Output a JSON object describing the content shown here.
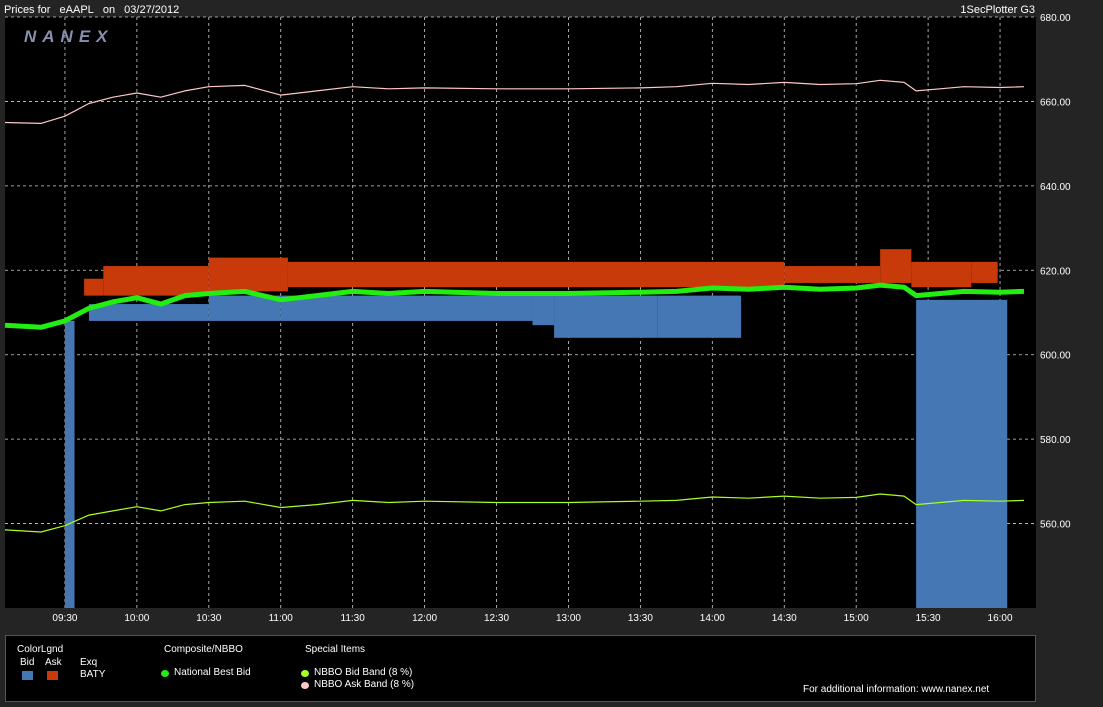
{
  "header": {
    "prefix": "Prices for",
    "symbol": "eAAPL",
    "on": "on",
    "date": "03/27/2012",
    "plotter": "1SecPlotter G3",
    "logo": "NANEX"
  },
  "colors": {
    "bid": "#4477b3",
    "ask": "#c83a0a",
    "nbb": "#22ee11",
    "nbbo_bid_band": "#aaff22",
    "nbbo_ask_band": "#ffc8c8",
    "grid": "#cfcfcf"
  },
  "legend": {
    "colorlgnd_title": "ColorLgnd",
    "bid_label": "Bid",
    "ask_label": "Ask",
    "exq_label": "Exq",
    "exchange": "BATY",
    "composite_title": "Composite/NBBO",
    "national_best_bid": "National Best Bid",
    "special_title": "Special Items",
    "nbbo_bid_band": "NBBO Bid Band (8 %)",
    "nbbo_ask_band": "NBBO Ask Band (8 %)",
    "info": "For additional information: www.nanex.net"
  },
  "chart_data": {
    "type": "line",
    "ylim": [
      540,
      680
    ],
    "xlim": [
      "09:05",
      "16:15"
    ],
    "x_ticks": [
      "09:30",
      "10:00",
      "10:30",
      "11:00",
      "11:30",
      "12:00",
      "12:30",
      "13:00",
      "13:30",
      "14:00",
      "14:30",
      "15:00",
      "15:30",
      "16:00"
    ],
    "y_ticks": [
      560,
      580,
      600,
      620,
      640,
      660,
      680
    ],
    "y_tick_labels": [
      "560.00",
      "580.00",
      "600.00",
      "620.00",
      "640.00",
      "660.00",
      "680.00"
    ],
    "grid": true,
    "series": [
      {
        "name": "National Best Bid",
        "x": [
          "09:05",
          "09:20",
          "09:30",
          "09:40",
          "09:50",
          "10:00",
          "10:10",
          "10:20",
          "10:30",
          "10:45",
          "11:00",
          "11:15",
          "11:30",
          "11:45",
          "12:00",
          "12:30",
          "13:00",
          "13:30",
          "13:45",
          "14:00",
          "14:15",
          "14:30",
          "14:45",
          "15:00",
          "15:10",
          "15:20",
          "15:25",
          "15:35",
          "15:45",
          "16:00",
          "16:10"
        ],
        "y": [
          607.0,
          606.5,
          608.0,
          611.0,
          612.5,
          613.5,
          612.0,
          614.0,
          614.5,
          615.0,
          613.0,
          614.0,
          615.0,
          614.5,
          615.0,
          614.5,
          614.5,
          614.8,
          615.0,
          615.8,
          615.5,
          616.0,
          615.5,
          615.8,
          616.5,
          616.0,
          614.0,
          614.5,
          615.0,
          614.8,
          615.0
        ]
      },
      {
        "name": "NBBO Bid Band (8 %)",
        "x": [
          "09:05",
          "09:20",
          "09:30",
          "09:40",
          "09:50",
          "10:00",
          "10:10",
          "10:20",
          "10:30",
          "10:45",
          "11:00",
          "11:15",
          "11:30",
          "11:45",
          "12:00",
          "12:30",
          "13:00",
          "13:30",
          "13:45",
          "14:00",
          "14:15",
          "14:30",
          "14:45",
          "15:00",
          "15:10",
          "15:20",
          "15:25",
          "15:35",
          "15:45",
          "16:00",
          "16:10"
        ],
        "y": [
          558.5,
          558.0,
          559.5,
          562.0,
          563.0,
          564.0,
          563.0,
          564.5,
          565.0,
          565.3,
          563.8,
          564.5,
          565.5,
          565.0,
          565.3,
          565.0,
          565.0,
          565.3,
          565.5,
          566.3,
          566.0,
          566.5,
          566.0,
          566.2,
          567.0,
          566.5,
          564.5,
          565.0,
          565.5,
          565.3,
          565.5
        ]
      },
      {
        "name": "NBBO Ask Band (8 %)",
        "x": [
          "09:05",
          "09:20",
          "09:30",
          "09:40",
          "09:50",
          "10:00",
          "10:10",
          "10:20",
          "10:30",
          "10:45",
          "11:00",
          "11:15",
          "11:30",
          "11:45",
          "12:00",
          "12:30",
          "13:00",
          "13:30",
          "13:45",
          "14:00",
          "14:15",
          "14:30",
          "14:45",
          "15:00",
          "15:10",
          "15:20",
          "15:25",
          "15:35",
          "15:45",
          "16:00",
          "16:10"
        ],
        "y": [
          655.0,
          654.8,
          656.5,
          659.5,
          661.0,
          662.0,
          661.0,
          662.5,
          663.5,
          663.8,
          661.5,
          662.5,
          663.5,
          663.0,
          663.2,
          663.0,
          663.0,
          663.2,
          663.5,
          664.3,
          664.0,
          664.5,
          664.0,
          664.2,
          665.0,
          664.5,
          662.5,
          663.0,
          663.5,
          663.3,
          663.5
        ]
      }
    ],
    "bid_segments": [
      {
        "x0": "09:30",
        "x1": "09:34",
        "top": 608.0,
        "bottom": 540.0
      },
      {
        "x0": "09:40",
        "x1": "10:30",
        "top": 612.0,
        "bottom": 608.0
      },
      {
        "x0": "10:30",
        "x1": "11:00",
        "top": 614.0,
        "bottom": 608.0
      },
      {
        "x0": "11:00",
        "x1": "12:45",
        "top": 614.0,
        "bottom": 608.0
      },
      {
        "x0": "12:45",
        "x1": "12:54",
        "top": 614.0,
        "bottom": 607.0
      },
      {
        "x0": "12:54",
        "x1": "13:37",
        "top": 614.0,
        "bottom": 604.0
      },
      {
        "x0": "13:37",
        "x1": "14:12",
        "top": 614.0,
        "bottom": 604.0
      },
      {
        "x0": "15:25",
        "x1": "16:03",
        "top": 613.0,
        "bottom": 540.0
      }
    ],
    "ask_segments": [
      {
        "x0": "09:38",
        "x1": "09:46",
        "top": 618.0,
        "bottom": 614.0
      },
      {
        "x0": "09:46",
        "x1": "10:30",
        "top": 621.0,
        "bottom": 614.0
      },
      {
        "x0": "10:30",
        "x1": "11:03",
        "top": 623.0,
        "bottom": 615.0
      },
      {
        "x0": "11:03",
        "x1": "14:30",
        "top": 622.0,
        "bottom": 616.0
      },
      {
        "x0": "14:30",
        "x1": "15:10",
        "top": 621.0,
        "bottom": 617.0
      },
      {
        "x0": "15:10",
        "x1": "15:23",
        "top": 625.0,
        "bottom": 617.0
      },
      {
        "x0": "15:23",
        "x1": "15:48",
        "top": 622.0,
        "bottom": 616.0
      },
      {
        "x0": "15:48",
        "x1": "15:59",
        "top": 622.0,
        "bottom": 617.0
      }
    ]
  }
}
